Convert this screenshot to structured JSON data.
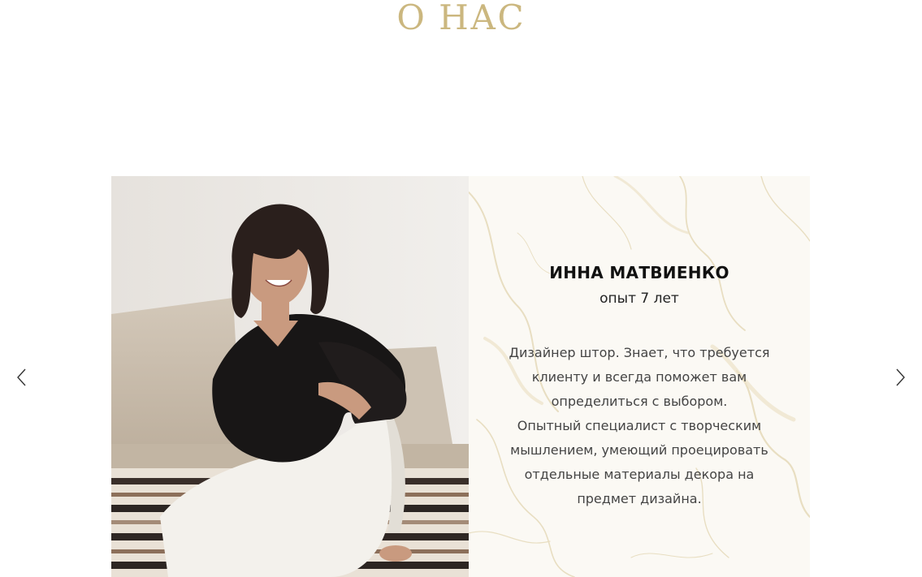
{
  "section": {
    "title": "О НАС"
  },
  "carousel": {
    "prev_icon": "chevron-left-icon",
    "next_icon": "chevron-right-icon",
    "slide": {
      "photo_alt": "Фото Инны Матвиенко",
      "name": "ИННА МАТВИЕНКО",
      "experience": "опыт 7 лет",
      "description_lines": [
        "Дизайнер штор. Знает, что требуется клиенту и всегда поможет вам определиться с выбором.",
        "Опытный специалист с творческим мышлением, умеющий проецировать отдельные материалы декора на предмет дизайна."
      ]
    }
  },
  "colors": {
    "accent": "#cbb77f",
    "text": "#111111",
    "body_text": "#444444"
  }
}
